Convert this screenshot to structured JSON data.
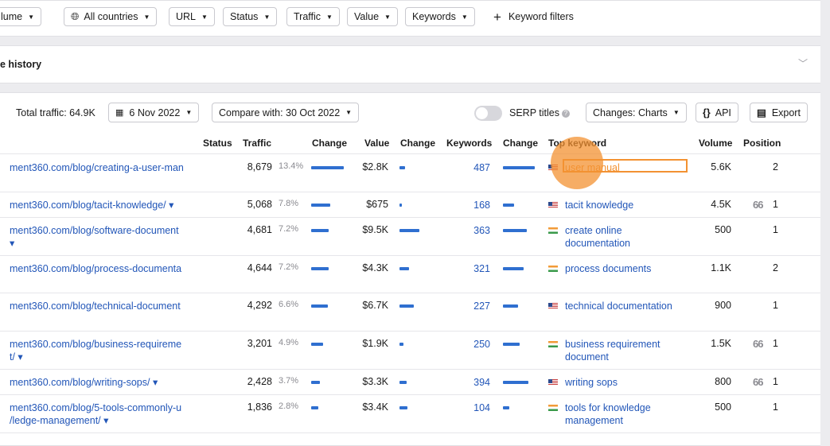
{
  "filters": {
    "volume": "lume",
    "countries": "All countries",
    "url": "URL",
    "status": "Status",
    "traffic": "Traffic",
    "value": "Value",
    "keywords": "Keywords",
    "keyword_filters": "Keyword filters"
  },
  "history": {
    "title": "e history"
  },
  "toolbar": {
    "total_traffic": "Total traffic: 64.9K",
    "date": "6 Nov 2022",
    "compare": "Compare with: 30 Oct 2022",
    "serp_titles": "SERP titles",
    "changes": "Changes: Charts",
    "api": "API",
    "export": "Export"
  },
  "columns": {
    "status": "Status",
    "traffic": "Traffic",
    "change1": "Change",
    "value": "Value",
    "change2": "Change",
    "keywords": "Keywords",
    "change3": "Change",
    "top_keyword": "Top keyword",
    "volume": "Volume",
    "position": "Position"
  },
  "rows": [
    {
      "url1": "ment360.com/blog/creating-a-user-man",
      "url2": "",
      "traffic": "8,679",
      "pct": "13.4%",
      "tbar": 0.94,
      "value": "$2.8K",
      "vbar": 0.15,
      "keywords": "487",
      "kbar": 0.95,
      "flag": "us",
      "kw1": "user manual",
      "kw2": "",
      "volume": "5.6K",
      "serp": false,
      "position": "2"
    },
    {
      "url1": "ment360.com/blog/tacit-knowledge/ ▾",
      "url2": "",
      "traffic": "5,068",
      "pct": "7.8%",
      "tbar": 0.55,
      "value": "$675",
      "vbar": 0.04,
      "keywords": "168",
      "kbar": 0.33,
      "flag": "us",
      "kw1": "tacit knowledge",
      "kw2": "",
      "volume": "4.5K",
      "serp": true,
      "position": "1"
    },
    {
      "url1": "ment360.com/blog/software-document",
      "url2": "▾",
      "traffic": "4,681",
      "pct": "7.2%",
      "tbar": 0.51,
      "value": "$9.5K",
      "vbar": 0.53,
      "keywords": "363",
      "kbar": 0.71,
      "flag": "in",
      "kw1": "create online",
      "kw2": "documentation",
      "volume": "500",
      "serp": false,
      "position": "1"
    },
    {
      "url1": "ment360.com/blog/process-documenta",
      "url2": "",
      "traffic": "4,644",
      "pct": "7.2%",
      "tbar": 0.5,
      "value": "$4.3K",
      "vbar": 0.24,
      "keywords": "321",
      "kbar": 0.63,
      "flag": "in",
      "kw1": "process documents",
      "kw2": "",
      "volume": "1.1K",
      "serp": false,
      "position": "2"
    },
    {
      "url1": "ment360.com/blog/technical-document",
      "url2": "",
      "traffic": "4,292",
      "pct": "6.6%",
      "tbar": 0.47,
      "value": "$6.7K",
      "vbar": 0.38,
      "keywords": "227",
      "kbar": 0.45,
      "flag": "us",
      "kw1": "technical documentation",
      "kw2": "",
      "volume": "900",
      "serp": false,
      "position": "1"
    },
    {
      "url1": "ment360.com/blog/business-requireme",
      "url2": "t/ ▾",
      "traffic": "3,201",
      "pct": "4.9%",
      "tbar": 0.35,
      "value": "$1.9K",
      "vbar": 0.11,
      "keywords": "250",
      "kbar": 0.49,
      "flag": "in",
      "kw1": "business requirement",
      "kw2": "document",
      "volume": "1.5K",
      "serp": true,
      "position": "1"
    },
    {
      "url1": "ment360.com/blog/writing-sops/ ▾",
      "url2": "",
      "traffic": "2,428",
      "pct": "3.7%",
      "tbar": 0.26,
      "value": "$3.3K",
      "vbar": 0.19,
      "keywords": "394",
      "kbar": 0.77,
      "flag": "us",
      "kw1": "writing sops",
      "kw2": "",
      "volume": "800",
      "serp": true,
      "position": "1"
    },
    {
      "url1": "ment360.com/blog/5-tools-commonly-u",
      "url2": "/ledge-management/ ▾",
      "traffic": "1,836",
      "pct": "2.8%",
      "tbar": 0.2,
      "value": "$3.4K",
      "vbar": 0.2,
      "keywords": "104",
      "kbar": 0.2,
      "flag": "in",
      "kw1": "tools for knowledge",
      "kw2": "management",
      "volume": "500",
      "serp": false,
      "position": "1"
    }
  ],
  "serp_quote": "66",
  "colors": {
    "accent": "#2f6fd0",
    "link": "#2256b8",
    "highlight": "#f39232"
  }
}
